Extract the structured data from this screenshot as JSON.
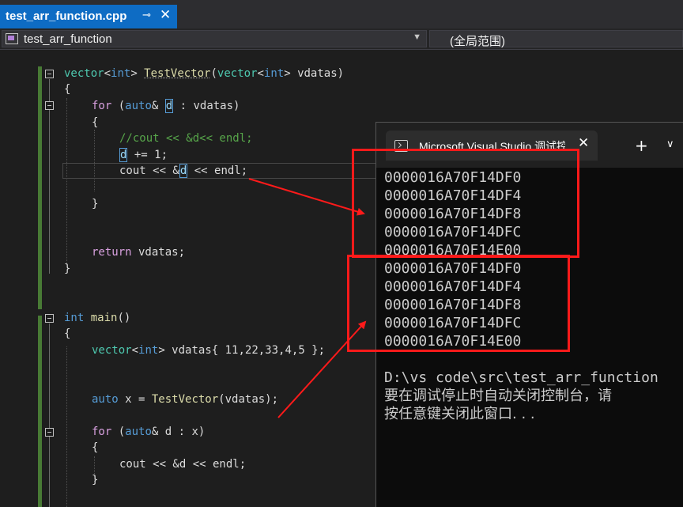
{
  "tab": {
    "title": "test_arr_function.cpp",
    "pin_icon": "pin-icon",
    "close_icon": "close-icon"
  },
  "navbar": {
    "project": "test_arr_function",
    "scope": "(全局范围)"
  },
  "code": {
    "l1": {
      "a": "vector",
      "b": "<",
      "c": "int",
      "d": "> ",
      "e": "TestVector",
      "f": "(",
      "g": "vector",
      "h": "<",
      "i": "int",
      "j": "> vdatas)"
    },
    "l2": "{",
    "l3": {
      "a": "for",
      "b": " (",
      "c": "auto",
      "d": "& ",
      "e": "d",
      "f": " : vdatas)"
    },
    "l4": "{",
    "l5": "//cout << &d<< endl;",
    "l6": {
      "a": "d",
      "b": " += 1;"
    },
    "l7": {
      "a": "cout << &",
      "b": "d",
      "c": " << endl;"
    },
    "l8": "}",
    "l9": {
      "a": "return",
      "b": " vdatas;"
    },
    "l10": "}",
    "l11": {
      "a": "int",
      "b": " ",
      "c": "main",
      "d": "()"
    },
    "l12": "{",
    "l13": {
      "a": "vector",
      "b": "<",
      "c": "int",
      "d": "> vdatas{ 11,22,33,4,5 };"
    },
    "l14": {
      "a": "auto",
      "b": " x = ",
      "c": "TestVector",
      "d": "(vdatas);"
    },
    "l15": {
      "a": "for",
      "b": " (",
      "c": "auto",
      "d": "& d : x)"
    },
    "l16": "{",
    "l17": "cout << &d << endl;",
    "l18": "}"
  },
  "console": {
    "title": "Microsoft Visual Studio 调试控制台",
    "terminal_icon": "terminal-icon",
    "close_icon": "close-icon",
    "add_icon": "plus-icon",
    "dropdown_icon": "chevron-down-icon",
    "output_first": [
      "0000016A70F14DF0",
      "0000016A70F14DF4",
      "0000016A70F14DF8",
      "0000016A70F14DFC",
      "0000016A70F14E00"
    ],
    "output_second": [
      "0000016A70F14DF0",
      "0000016A70F14DF4",
      "0000016A70F14DF8",
      "0000016A70F14DFC",
      "0000016A70F14E00"
    ],
    "path_line": "D:\\vs code\\src\\test_arr_function",
    "msg_line1": "要在调试停止时自动关闭控制台，请",
    "msg_line2": "按任意键关闭此窗口. . ."
  },
  "colors": {
    "tab_active": "#0e6cc4",
    "annotation_red": "#ff1a1a",
    "keyword": "#569cd6",
    "type": "#4ec9b0",
    "function": "#dcdcaa",
    "comment": "#57a64a",
    "control": "#d8a0df",
    "change_bar": "#487a35"
  }
}
